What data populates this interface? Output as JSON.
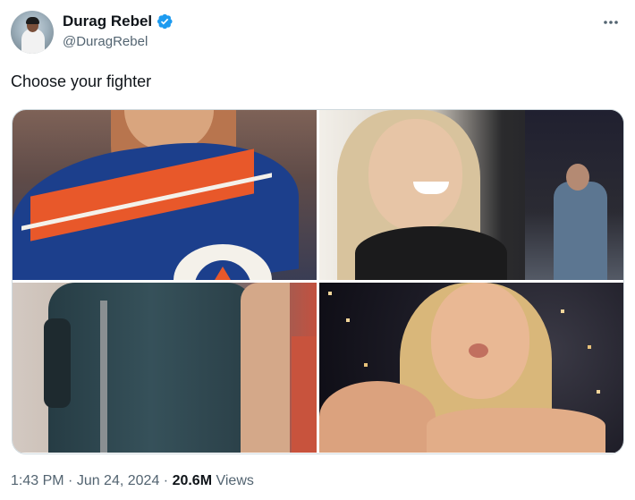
{
  "author": {
    "display_name": "Durag Rebel",
    "handle": "@DuragRebel",
    "verified": true
  },
  "icons": {
    "verified": "verified-badge-icon",
    "more": "more-options-icon"
  },
  "tweet": {
    "text": "Choose your fighter",
    "media_count": 4
  },
  "meta": {
    "time": "1:43 PM",
    "separator": " · ",
    "date": "Jun 24, 2024",
    "views_count": "20.6M",
    "views_label": " Views"
  },
  "colors": {
    "text_primary": "#0f1419",
    "text_secondary": "#536471",
    "verified_blue": "#1d9bf0",
    "border": "#cfd9de"
  }
}
